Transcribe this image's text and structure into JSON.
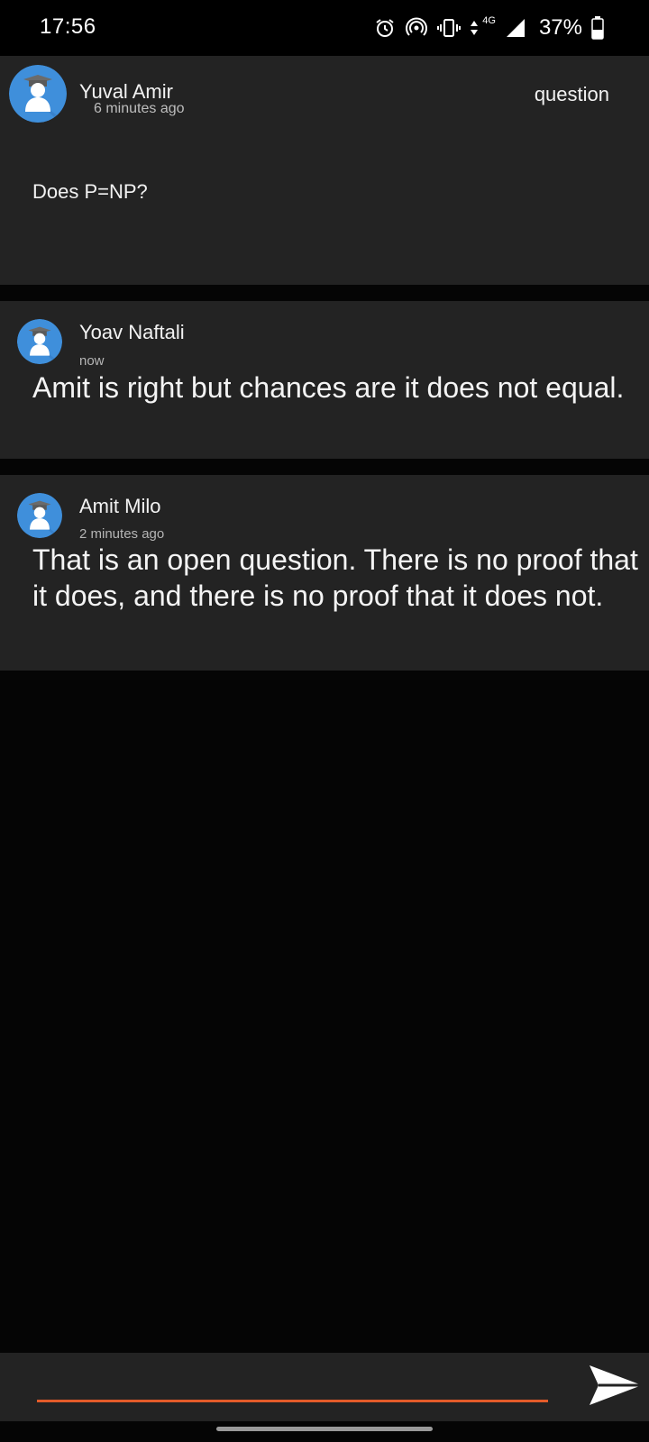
{
  "status_bar": {
    "time": "17:56",
    "network": "4G",
    "battery": "37%"
  },
  "question": {
    "author": "Yuval Amir",
    "time": "6 minutes ago",
    "tag": "question",
    "body": "Does P=NP?"
  },
  "answers": [
    {
      "author": "Yoav Naftali",
      "time": "now",
      "body": "Amit is right but chances are it does not equal."
    },
    {
      "author": "Amit Milo",
      "time": "2 minutes ago",
      "body": "That is an open question. There is no proof that it does, and there is no proof that it does not."
    }
  ],
  "composer": {
    "value": "",
    "placeholder": ""
  },
  "colors": {
    "background": "#050505",
    "card": "#232323",
    "accent_underline": "#e35b2a",
    "avatar_blue": "#3f8fdb"
  },
  "icons": {
    "alarm": "alarm-icon",
    "hotspot": "hotspot-icon",
    "vibrate": "vibrate-icon",
    "signal": "signal-icon",
    "battery": "battery-icon",
    "avatar": "graduate-avatar-icon",
    "send": "send-icon"
  }
}
